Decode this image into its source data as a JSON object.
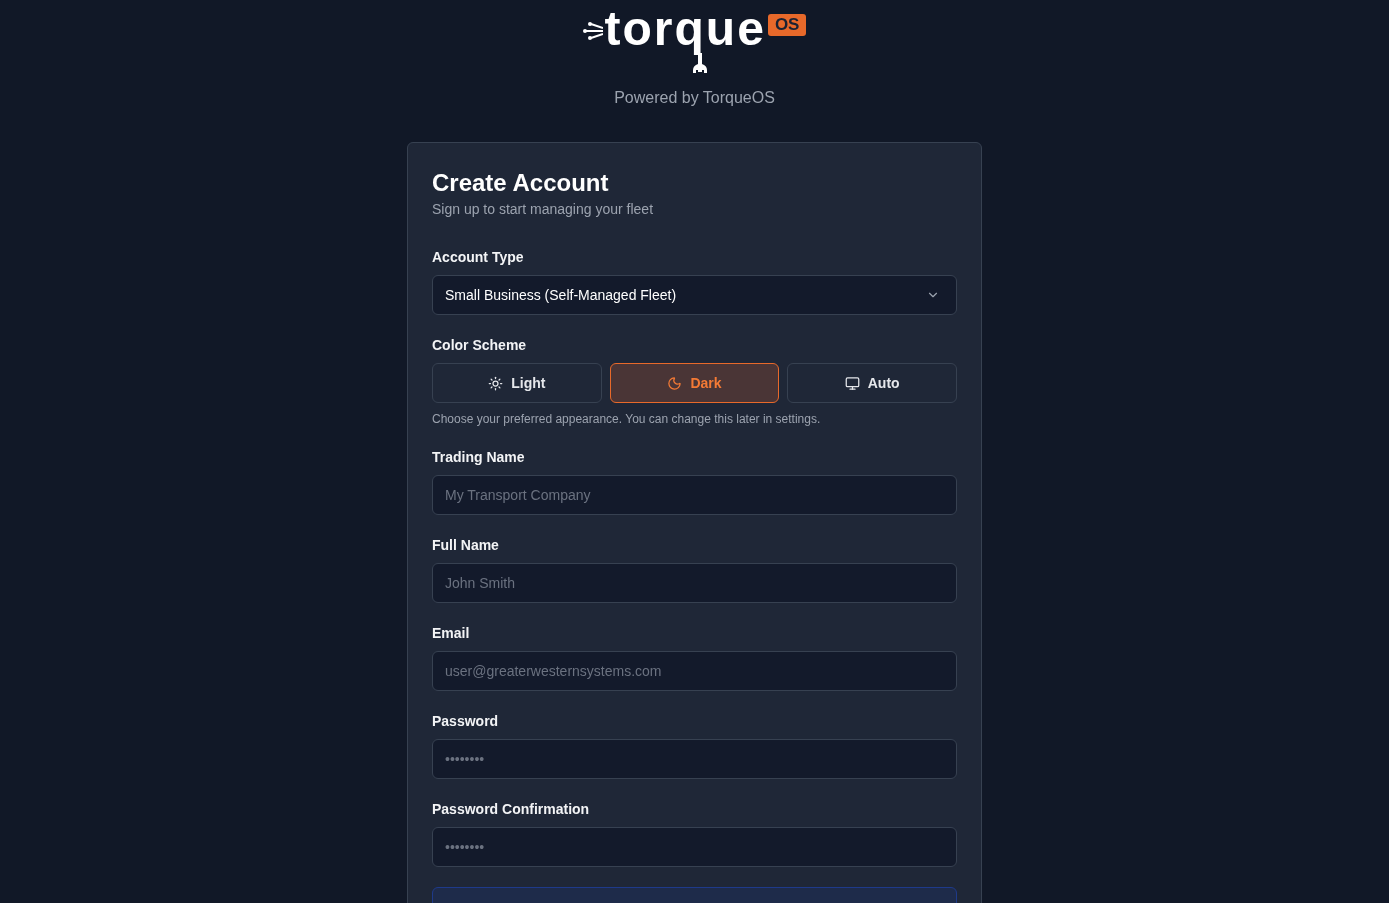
{
  "logo": {
    "wordmark": "torque",
    "badge": "OS"
  },
  "tagline": "Powered by TorqueOS",
  "form": {
    "title": "Create Account",
    "subtitle": "Sign up to start managing your fleet",
    "account_type": {
      "label": "Account Type",
      "value": "Small Business (Self-Managed Fleet)"
    },
    "color_scheme": {
      "label": "Color Scheme",
      "options": [
        {
          "label": "Light",
          "selected": false
        },
        {
          "label": "Dark",
          "selected": true
        },
        {
          "label": "Auto",
          "selected": false
        }
      ],
      "hint": "Choose your preferred appearance. You can change this later in settings."
    },
    "fields": [
      {
        "label": "Trading Name",
        "placeholder": "My Transport Company"
      },
      {
        "label": "Full Name",
        "placeholder": "John Smith"
      },
      {
        "label": "Email",
        "placeholder": "user@greaterwesternsystems.com"
      },
      {
        "label": "Password",
        "placeholder": "••••••••"
      },
      {
        "label": "Password Confirmation",
        "placeholder": "••••••••"
      }
    ]
  }
}
